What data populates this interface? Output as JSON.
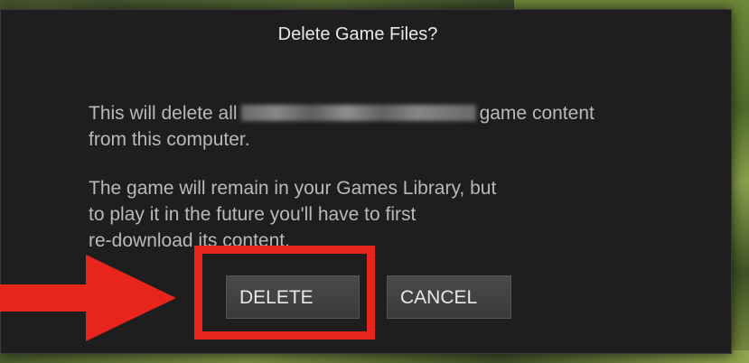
{
  "dialog": {
    "title": "Delete Game Files?",
    "message": {
      "line1_prefix": "This will delete all",
      "line1_suffix": "game content",
      "line2": "from this computer.",
      "line3": "The game will remain in your Games Library, but",
      "line4": "to play it in the future you'll have to first",
      "line5": "re-download its content."
    },
    "buttons": {
      "delete_label": "DELETE",
      "cancel_label": "CANCEL"
    }
  },
  "annotation": {
    "highlight_color": "#e8251c",
    "arrow_color": "#e8251c"
  },
  "colors": {
    "dialog_background": "#1e1e1e",
    "title_text": "#e9e9e9",
    "body_text": "#b9b9b9",
    "button_background": "#434343"
  }
}
